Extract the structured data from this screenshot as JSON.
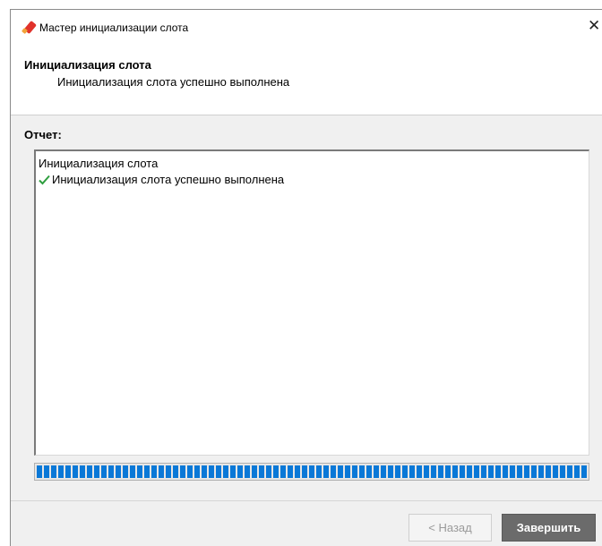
{
  "window": {
    "title": "Мастер инициализации слота",
    "close_glyph": "✕"
  },
  "header": {
    "title": "Инициализация слота",
    "subtitle": "Инициализация слота успешно выполнена"
  },
  "report": {
    "label": "Отчет:",
    "lines": [
      {
        "text": "Инициализация слота",
        "icon": null
      },
      {
        "text": "Инициализация слота успешно выполнена",
        "icon": "checkmark-icon"
      }
    ]
  },
  "progress": {
    "fraction": 1.0
  },
  "buttons": {
    "back_label": "< Назад",
    "finish_label": "Завершить"
  },
  "colors": {
    "progress_blue": "#0a78d7",
    "check_green": "#2e9e3e",
    "icon_red": "#e0322b"
  }
}
